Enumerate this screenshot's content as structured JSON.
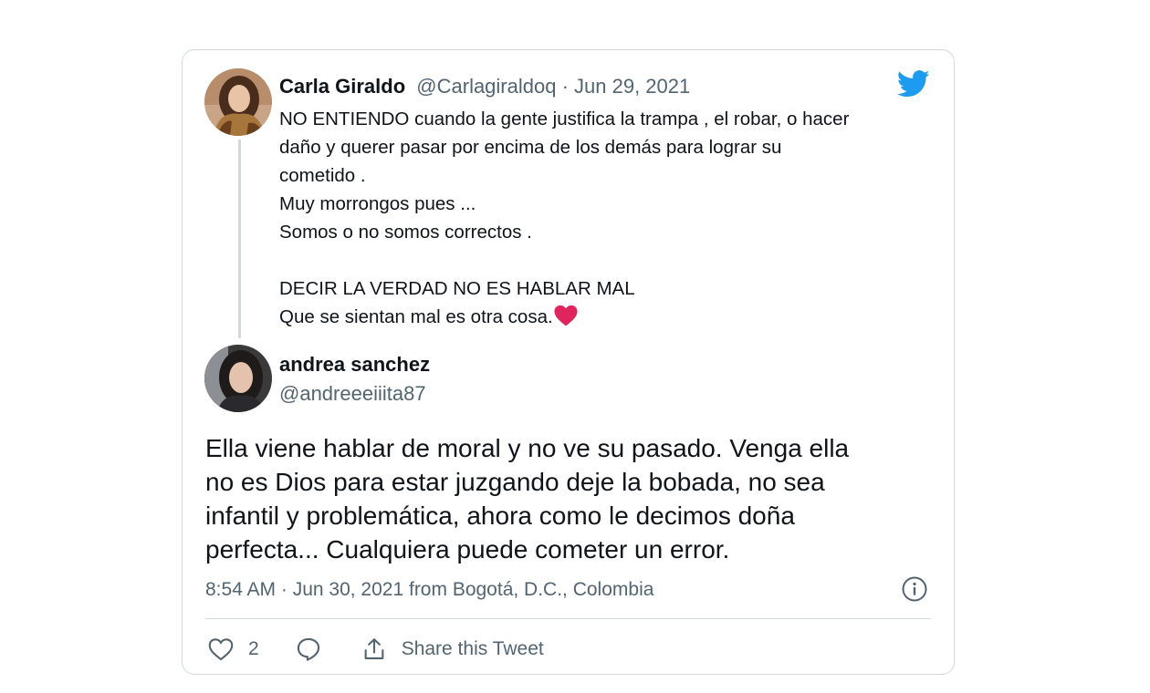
{
  "quoted_tweet": {
    "display_name": "Carla Giraldo",
    "handle": "@Carlagiraldoq",
    "separator": " · ",
    "date": "Jun 29, 2021",
    "lines": [
      "NO ENTIENDO  cuando la gente justifica la trampa , el robar, o hacer",
      "daño y querer pasar por encima  de los demás para lograr su",
      "cometido .",
      "Muy morrongos pues ...",
      "Somos o no somos correctos .",
      "",
      "DECIR LA VERDAD NO ES HABLAR MAL",
      "Que se sientan mal es otra cosa."
    ],
    "emoji": "red-heart"
  },
  "reply_tweet": {
    "display_name": "andrea sanchez",
    "handle": "@andreeeiiita87",
    "lines": [
      "Ella viene hablar de moral y no ve su pasado. Venga ella",
      "no es Dios para estar juzgando deje la bobada, no sea",
      "infantil y problemática, ahora como le decimos doña",
      "perfecta... Cualquiera puede cometer un error."
    ],
    "timestamp": "8:54 AM · Jun 30, 2021 from Bogotá, D.C., Colombia"
  },
  "actions": {
    "like_count": "2",
    "share_label": "Share this Tweet"
  },
  "icons": {
    "brand": "twitter-bird-icon",
    "info": "info-icon",
    "like": "heart-icon",
    "reply": "reply-icon",
    "share": "share-icon"
  },
  "colors": {
    "twitter_blue": "#1d9bf0",
    "text_primary": "#0f1419",
    "text_secondary": "#536471",
    "border": "#cfd9de",
    "emoji_heart": "#e0245e"
  }
}
